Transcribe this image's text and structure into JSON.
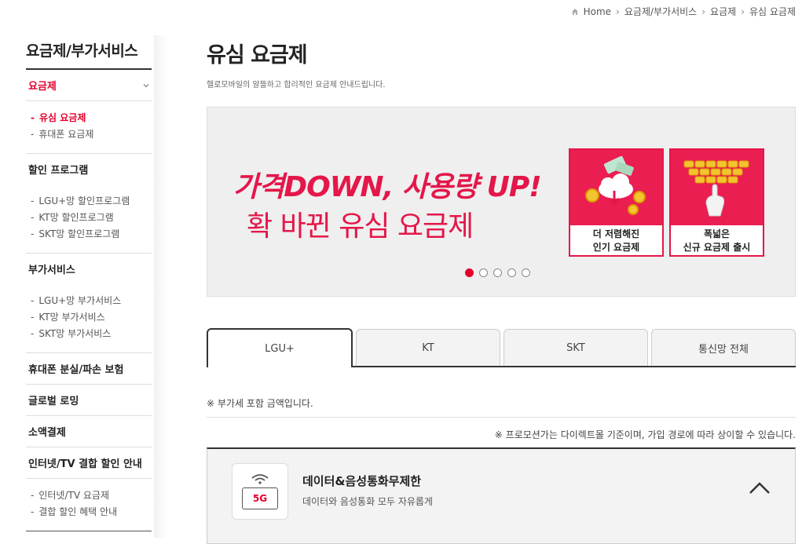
{
  "breadcrumb": {
    "items": [
      "Home",
      "요금제/부가서비스",
      "요금제",
      "유심 요금제"
    ]
  },
  "sidebar": {
    "title": "요금제/부가서비스",
    "groups": [
      {
        "label": "요금제",
        "items": [
          "유심 요금제",
          "휴대폰 요금제"
        ]
      },
      {
        "label": "할인 프로그램",
        "items": [
          "LGU+망 할인프로그램",
          "KT망 할인프로그램",
          "SKT망 할인프로그램"
        ]
      },
      {
        "label": "부가서비스",
        "items": [
          "LGU+망 부가서비스",
          "KT망 부가서비스",
          "SKT망 부가서비스"
        ]
      },
      {
        "label": "휴대폰 분실/파손 보험"
      },
      {
        "label": "글로벌 로밍"
      },
      {
        "label": "소액결제"
      },
      {
        "label": "인터넷/TV 결합 할인 안내",
        "items": [
          "인터넷/TV 요금제",
          "결합 할인 혜택 안내"
        ]
      }
    ]
  },
  "main": {
    "title": "유심 요금제",
    "description": "헬로모바일의 알뜰하고 합리적인 요금제 안내드립니다."
  },
  "banner": {
    "headline": "가격DOWN, 사용량 UP!",
    "subline": "확 바뀐 유심 요금제",
    "cards": [
      {
        "line1": "더 저렴해진",
        "line2": "인기 요금제"
      },
      {
        "line1": "폭넓은",
        "line2": "신규 요금제 출시"
      }
    ],
    "slide_count": 5,
    "active_slide": 1
  },
  "tabs": [
    {
      "label": "LGU+",
      "active": true
    },
    {
      "label": "KT",
      "active": false
    },
    {
      "label": "SKT",
      "active": false
    },
    {
      "label": "통신망 전체",
      "active": false
    }
  ],
  "notes": {
    "vat": "※ 부가세 포함 금액입니다.",
    "promotion": "※ 프로모션가는 다이렉트몰 기준이며, 가입 경로에 따라 상이할 수 있습니다."
  },
  "plan": {
    "icon_label": "5G",
    "title": "데이터&음성통화무제한",
    "description": "데이터와 음성통화 모두 자유롭게"
  },
  "colors": {
    "accent": "#e4002b",
    "banner_pink": "#e4174a"
  }
}
